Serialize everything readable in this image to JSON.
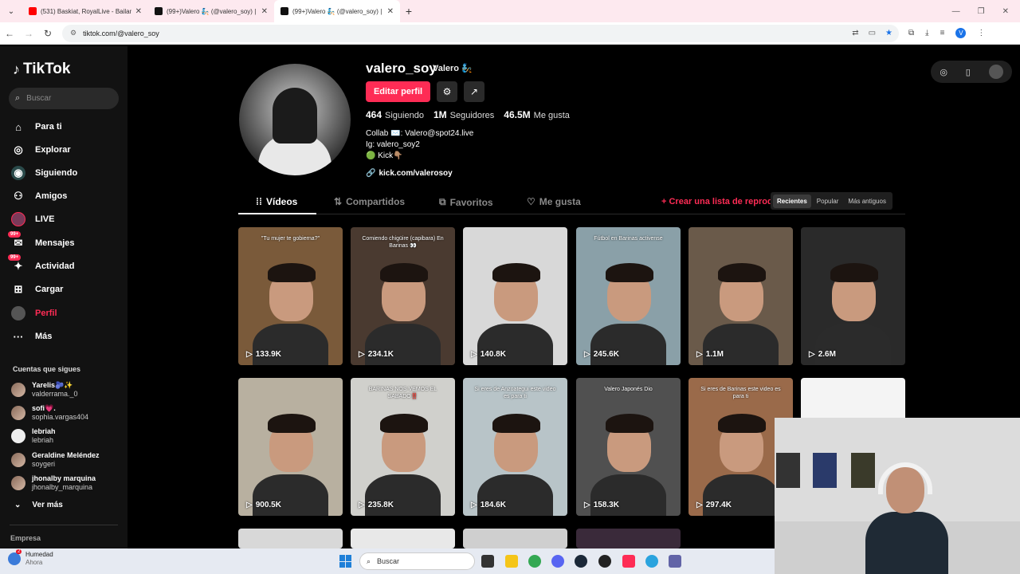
{
  "browser": {
    "tabs": [
      {
        "title": "(531) Baskiat, RoyalLive - Bailan",
        "fav": "#ff0000"
      },
      {
        "title": "(99+)Valero 🧞 (@valero_soy) | T",
        "fav": "#111111"
      },
      {
        "title": "(99+)Valero 🧞 (@valero_soy) | T",
        "fav": "#111111"
      }
    ],
    "new_tab": "+",
    "url": "tiktok.com/@valero_soy",
    "profile_initial": "V"
  },
  "sidebar": {
    "logo": "TikTok",
    "search_placeholder": "Buscar",
    "nav": [
      {
        "label": "Para ti",
        "icon": "home-icon",
        "glyph": "⌂"
      },
      {
        "label": "Explorar",
        "icon": "compass-icon",
        "glyph": "◎"
      },
      {
        "label": "Siguiendo",
        "icon": "following-icon",
        "glyph": "◉"
      },
      {
        "label": "Amigos",
        "icon": "friends-icon",
        "glyph": "⚇"
      },
      {
        "label": "LIVE",
        "icon": "live-icon",
        "glyph": "●"
      },
      {
        "label": "Mensajes",
        "icon": "messages-icon",
        "glyph": "✉",
        "badge": "99+"
      },
      {
        "label": "Actividad",
        "icon": "activity-icon",
        "glyph": "✦",
        "badge": "99+"
      },
      {
        "label": "Cargar",
        "icon": "upload-icon",
        "glyph": "⊞"
      },
      {
        "label": "Perfil",
        "icon": "profile-icon",
        "glyph": "●"
      },
      {
        "label": "Más",
        "icon": "more-icon",
        "glyph": "···"
      }
    ],
    "following_title": "Cuentas que sigues",
    "following": [
      {
        "name": "Yarelis🫐✨",
        "handle": "valderrama._0"
      },
      {
        "name": "sofi💗.",
        "handle": "sophia.vargas404"
      },
      {
        "name": "lebriah",
        "handle": "lebriah"
      },
      {
        "name": "Geraldine Meléndez",
        "handle": "soygeri"
      },
      {
        "name": "jhonalby marquina",
        "handle": "jhonalby_marquina"
      }
    ],
    "see_more": "Ver más",
    "footer": "Empresa"
  },
  "profile": {
    "username": "valero_soy",
    "display_name": "Valero 🧞",
    "edit_button": "Editar perfil",
    "following_count": "464",
    "following_label": "Siguiendo",
    "followers_count": "1M",
    "followers_label": "Seguidores",
    "likes_count": "46.5M",
    "likes_label": "Me gusta",
    "bio": [
      "Collab ✉️: Valero@spot24.live",
      "Ig: valero_soy2",
      "🟢 Kick👇🏽"
    ],
    "link": "kick.com/valerosoy"
  },
  "tabs": {
    "videos": "Vídeos",
    "shared": "Compartidos",
    "favorites": "Favoritos",
    "liked": "Me gusta",
    "create_playlist": "+ Crear una lista de reproducción"
  },
  "sort": {
    "recent": "Recientes",
    "popular": "Popular",
    "oldest": "Más antiguos"
  },
  "videos": [
    {
      "views": "133.9K",
      "caption": "\"Tu mujer te gobierna?\"",
      "bg": "#7a5a3a"
    },
    {
      "views": "234.1K",
      "caption": "Comiendo chigüire (capibara) En Barinas 👀",
      "bg": "#4a3a30"
    },
    {
      "views": "140.8K",
      "caption": "",
      "bg": "#d8d8d8"
    },
    {
      "views": "245.6K",
      "caption": "Fútbol en Barinas activense",
      "bg": "#8aa0a8"
    },
    {
      "views": "1.1M",
      "caption": "",
      "bg": "#6a5a4a"
    },
    {
      "views": "2.6M",
      "caption": "",
      "bg": "#2a2a2a"
    },
    {
      "views": "900.5K",
      "caption": "",
      "bg": "#b8b0a0"
    },
    {
      "views": "235.8K",
      "caption": "BARINAS NOS VEMOS EL SABADO‼️",
      "bg": "#d0d0cc"
    },
    {
      "views": "184.6K",
      "caption": "Si eres de Anzoategui este video es para ti",
      "bg": "#b8c4c8"
    },
    {
      "views": "158.3K",
      "caption": "Valero Japonés Dio",
      "bg": "#505050"
    },
    {
      "views": "297.4K",
      "caption": "Si eres de Barinas este video es para ti",
      "bg": "#9a6a4a"
    },
    {
      "views": "",
      "caption": "",
      "bg": "#f4f4f4"
    }
  ],
  "taskbar": {
    "weather_title": "Humedad",
    "weather_sub": "Ahora",
    "weather_badge": "2",
    "search": "Buscar"
  }
}
